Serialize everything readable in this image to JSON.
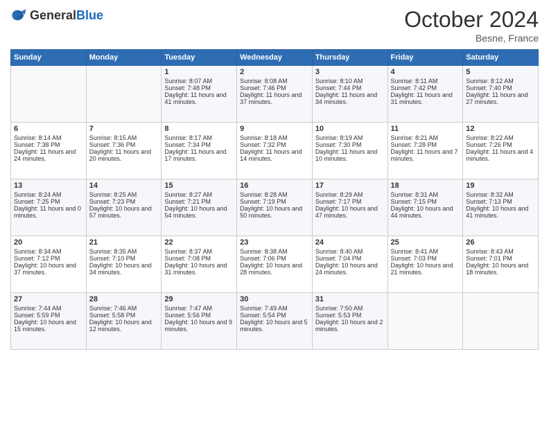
{
  "logo": {
    "general": "General",
    "blue": "Blue"
  },
  "header": {
    "month": "October 2024",
    "location": "Besne, France"
  },
  "weekdays": [
    "Sunday",
    "Monday",
    "Tuesday",
    "Wednesday",
    "Thursday",
    "Friday",
    "Saturday"
  ],
  "weeks": [
    [
      {
        "day": "",
        "sunrise": "",
        "sunset": "",
        "daylight": ""
      },
      {
        "day": "",
        "sunrise": "",
        "sunset": "",
        "daylight": ""
      },
      {
        "day": "1",
        "sunrise": "Sunrise: 8:07 AM",
        "sunset": "Sunset: 7:48 PM",
        "daylight": "Daylight: 11 hours and 41 minutes."
      },
      {
        "day": "2",
        "sunrise": "Sunrise: 8:08 AM",
        "sunset": "Sunset: 7:46 PM",
        "daylight": "Daylight: 11 hours and 37 minutes."
      },
      {
        "day": "3",
        "sunrise": "Sunrise: 8:10 AM",
        "sunset": "Sunset: 7:44 PM",
        "daylight": "Daylight: 11 hours and 34 minutes."
      },
      {
        "day": "4",
        "sunrise": "Sunrise: 8:11 AM",
        "sunset": "Sunset: 7:42 PM",
        "daylight": "Daylight: 11 hours and 31 minutes."
      },
      {
        "day": "5",
        "sunrise": "Sunrise: 8:12 AM",
        "sunset": "Sunset: 7:40 PM",
        "daylight": "Daylight: 11 hours and 27 minutes."
      }
    ],
    [
      {
        "day": "6",
        "sunrise": "Sunrise: 8:14 AM",
        "sunset": "Sunset: 7:38 PM",
        "daylight": "Daylight: 11 hours and 24 minutes."
      },
      {
        "day": "7",
        "sunrise": "Sunrise: 8:15 AM",
        "sunset": "Sunset: 7:36 PM",
        "daylight": "Daylight: 11 hours and 20 minutes."
      },
      {
        "day": "8",
        "sunrise": "Sunrise: 8:17 AM",
        "sunset": "Sunset: 7:34 PM",
        "daylight": "Daylight: 11 hours and 17 minutes."
      },
      {
        "day": "9",
        "sunrise": "Sunrise: 8:18 AM",
        "sunset": "Sunset: 7:32 PM",
        "daylight": "Daylight: 11 hours and 14 minutes."
      },
      {
        "day": "10",
        "sunrise": "Sunrise: 8:19 AM",
        "sunset": "Sunset: 7:30 PM",
        "daylight": "Daylight: 11 hours and 10 minutes."
      },
      {
        "day": "11",
        "sunrise": "Sunrise: 8:21 AM",
        "sunset": "Sunset: 7:28 PM",
        "daylight": "Daylight: 11 hours and 7 minutes."
      },
      {
        "day": "12",
        "sunrise": "Sunrise: 8:22 AM",
        "sunset": "Sunset: 7:26 PM",
        "daylight": "Daylight: 11 hours and 4 minutes."
      }
    ],
    [
      {
        "day": "13",
        "sunrise": "Sunrise: 8:24 AM",
        "sunset": "Sunset: 7:25 PM",
        "daylight": "Daylight: 11 hours and 0 minutes."
      },
      {
        "day": "14",
        "sunrise": "Sunrise: 8:25 AM",
        "sunset": "Sunset: 7:23 PM",
        "daylight": "Daylight: 10 hours and 57 minutes."
      },
      {
        "day": "15",
        "sunrise": "Sunrise: 8:27 AM",
        "sunset": "Sunset: 7:21 PM",
        "daylight": "Daylight: 10 hours and 54 minutes."
      },
      {
        "day": "16",
        "sunrise": "Sunrise: 8:28 AM",
        "sunset": "Sunset: 7:19 PM",
        "daylight": "Daylight: 10 hours and 50 minutes."
      },
      {
        "day": "17",
        "sunrise": "Sunrise: 8:29 AM",
        "sunset": "Sunset: 7:17 PM",
        "daylight": "Daylight: 10 hours and 47 minutes."
      },
      {
        "day": "18",
        "sunrise": "Sunrise: 8:31 AM",
        "sunset": "Sunset: 7:15 PM",
        "daylight": "Daylight: 10 hours and 44 minutes."
      },
      {
        "day": "19",
        "sunrise": "Sunrise: 8:32 AM",
        "sunset": "Sunset: 7:13 PM",
        "daylight": "Daylight: 10 hours and 41 minutes."
      }
    ],
    [
      {
        "day": "20",
        "sunrise": "Sunrise: 8:34 AM",
        "sunset": "Sunset: 7:12 PM",
        "daylight": "Daylight: 10 hours and 37 minutes."
      },
      {
        "day": "21",
        "sunrise": "Sunrise: 8:35 AM",
        "sunset": "Sunset: 7:10 PM",
        "daylight": "Daylight: 10 hours and 34 minutes."
      },
      {
        "day": "22",
        "sunrise": "Sunrise: 8:37 AM",
        "sunset": "Sunset: 7:08 PM",
        "daylight": "Daylight: 10 hours and 31 minutes."
      },
      {
        "day": "23",
        "sunrise": "Sunrise: 8:38 AM",
        "sunset": "Sunset: 7:06 PM",
        "daylight": "Daylight: 10 hours and 28 minutes."
      },
      {
        "day": "24",
        "sunrise": "Sunrise: 8:40 AM",
        "sunset": "Sunset: 7:04 PM",
        "daylight": "Daylight: 10 hours and 24 minutes."
      },
      {
        "day": "25",
        "sunrise": "Sunrise: 8:41 AM",
        "sunset": "Sunset: 7:03 PM",
        "daylight": "Daylight: 10 hours and 21 minutes."
      },
      {
        "day": "26",
        "sunrise": "Sunrise: 8:43 AM",
        "sunset": "Sunset: 7:01 PM",
        "daylight": "Daylight: 10 hours and 18 minutes."
      }
    ],
    [
      {
        "day": "27",
        "sunrise": "Sunrise: 7:44 AM",
        "sunset": "Sunset: 5:59 PM",
        "daylight": "Daylight: 10 hours and 15 minutes."
      },
      {
        "day": "28",
        "sunrise": "Sunrise: 7:46 AM",
        "sunset": "Sunset: 5:58 PM",
        "daylight": "Daylight: 10 hours and 12 minutes."
      },
      {
        "day": "29",
        "sunrise": "Sunrise: 7:47 AM",
        "sunset": "Sunset: 5:56 PM",
        "daylight": "Daylight: 10 hours and 9 minutes."
      },
      {
        "day": "30",
        "sunrise": "Sunrise: 7:49 AM",
        "sunset": "Sunset: 5:54 PM",
        "daylight": "Daylight: 10 hours and 5 minutes."
      },
      {
        "day": "31",
        "sunrise": "Sunrise: 7:50 AM",
        "sunset": "Sunset: 5:53 PM",
        "daylight": "Daylight: 10 hours and 2 minutes."
      },
      {
        "day": "",
        "sunrise": "",
        "sunset": "",
        "daylight": ""
      },
      {
        "day": "",
        "sunrise": "",
        "sunset": "",
        "daylight": ""
      }
    ]
  ]
}
